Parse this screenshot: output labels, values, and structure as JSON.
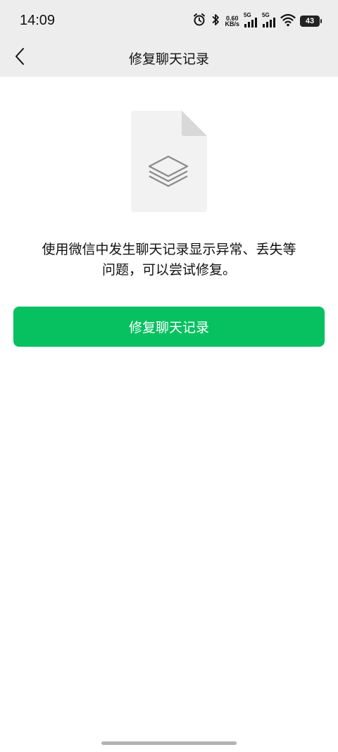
{
  "status_bar": {
    "time": "14:09",
    "net_speed_value": "0.60",
    "net_speed_unit": "KB/s",
    "signal1_label": "5G",
    "signal2_label": "5G",
    "battery": "43"
  },
  "nav": {
    "title": "修复聊天记录"
  },
  "main": {
    "description_line1": "使用微信中发生聊天记录显示异常、丢失等",
    "description_line2": "问题，可以尝试修复。",
    "repair_button_label": "修复聊天记录"
  },
  "colors": {
    "accent": "#07c160",
    "header_bg": "#ededed"
  }
}
